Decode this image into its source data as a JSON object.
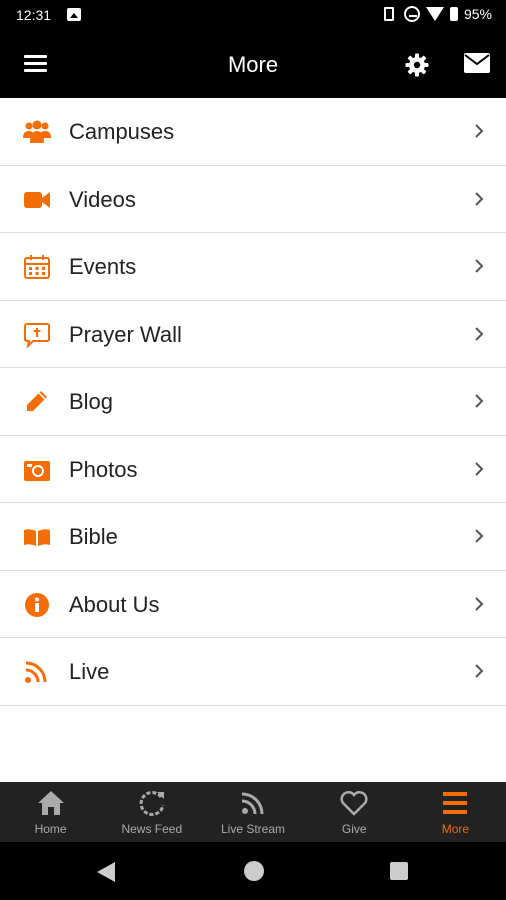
{
  "status_bar": {
    "time": "12:31",
    "battery": "95%"
  },
  "app_bar": {
    "title": "More",
    "icons": [
      "hamburger-menu-icon",
      "gear-icon",
      "mail-icon"
    ]
  },
  "colors": {
    "accent": "#F56D07",
    "bar_background": "#000000",
    "tab_background": "#222222"
  },
  "menu": {
    "items": [
      {
        "label": "Campuses",
        "icon": "users-icon"
      },
      {
        "label": "Videos",
        "icon": "video-camera-icon"
      },
      {
        "label": "Events",
        "icon": "calendar-icon"
      },
      {
        "label": "Prayer Wall",
        "icon": "prayer-speech-icon"
      },
      {
        "label": "Blog",
        "icon": "pencil-icon"
      },
      {
        "label": "Photos",
        "icon": "camera-icon"
      },
      {
        "label": "Bible",
        "icon": "open-book-icon"
      },
      {
        "label": "About Us",
        "icon": "info-icon"
      },
      {
        "label": "Live",
        "icon": "rss-icon"
      }
    ]
  },
  "tabs": [
    {
      "label": "Home",
      "icon": "home-icon"
    },
    {
      "label": "News Feed",
      "icon": "refresh-icon"
    },
    {
      "label": "Live Stream",
      "icon": "rss-icon"
    },
    {
      "label": "Give",
      "icon": "heart-icon"
    },
    {
      "label": "More",
      "icon": "hamburger-menu-icon",
      "active": true
    }
  ]
}
